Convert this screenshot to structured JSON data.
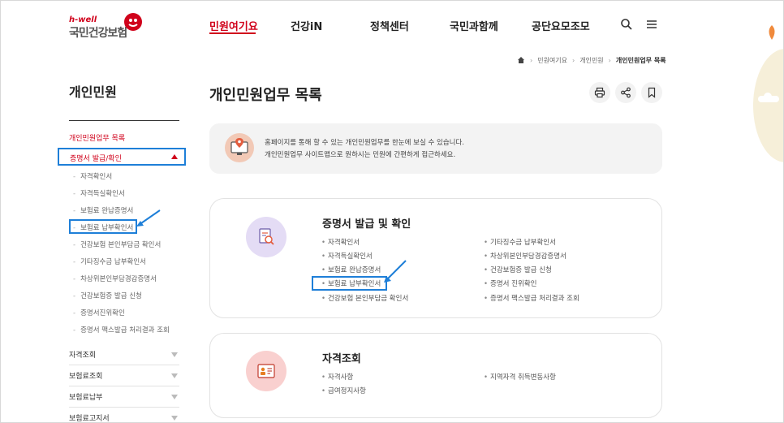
{
  "header": {
    "logo_sub": "h-well",
    "logo_main": "국민건강보험",
    "nav": [
      "민원여기요",
      "건강iN",
      "정책센터",
      "국민과함께",
      "공단요모조모"
    ],
    "active_index": 0
  },
  "breadcrumb": [
    "민원여기요",
    "개인민원",
    "개인민원업무 목록"
  ],
  "sidebar": {
    "title": "개인민원",
    "top_link": "개인민원업무 목록",
    "expanded_label": "증명서 발급/확인",
    "sub_items": [
      "자격확인서",
      "자격득실확인서",
      "보험료 완납증명서",
      "보험료 납부확인서",
      "건강보험 본인부담금 확인서",
      "기타징수금 납부확인서",
      "차상위본인부담경감증명서",
      "건강보험증 발급 신청",
      "증명서진위확인",
      "증명서 팩스발급 처리결과 조회"
    ],
    "groups": [
      "자격조회",
      "보험료조회",
      "보험료납부",
      "보험료고지서"
    ]
  },
  "main": {
    "title": "개인민원업무 목록",
    "notice_line1": "홈페이지를 통해 할 수 있는 개인민원업무를 한눈에 보실 수 있습니다.",
    "notice_line2": "개인민원업무 사이트맵으로 원하시는 민원에 간편하게 접근하세요."
  },
  "cards": [
    {
      "title": "증명서 발급 및 확인",
      "left": [
        "자격확인서",
        "자격득실확인서",
        "보험료 완납증명서",
        "보험료 납부확인서",
        "건강보험 본인부담금 확인서"
      ],
      "right": [
        "기타징수금 납부확인서",
        "차상위본인부담경감증명서",
        "건강보험증 발급 신청",
        "증명서 진위확인",
        "증명서 팩스발급 처리결과 조회"
      ]
    },
    {
      "title": "자격조회",
      "left": [
        "자격사항",
        "급여정지사항"
      ],
      "right": [
        "지역자격 취득변동사항"
      ]
    }
  ],
  "colors": {
    "brand": "#d0021b",
    "highlight": "#1e7fd8"
  },
  "icons": [
    "search-icon",
    "menu-icon",
    "home-icon",
    "print-icon",
    "share-icon",
    "bookmark-icon",
    "location-monitor-icon",
    "document-search-icon",
    "id-card-icon"
  ]
}
